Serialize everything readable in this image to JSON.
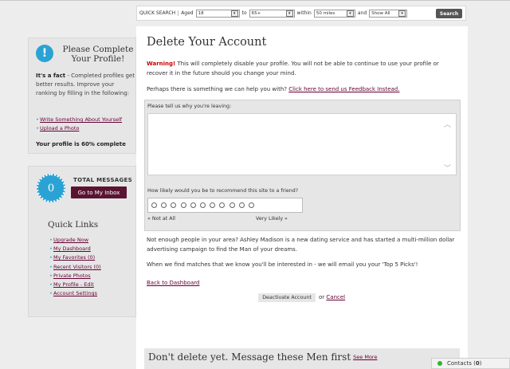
{
  "search": {
    "quick_search": "QUICK SEARCH",
    "aged": "Aged",
    "age_from": "18",
    "to": "to",
    "age_to": "65+",
    "within": "within",
    "distance": "50 miles",
    "and": "and",
    "show": "Show All",
    "button": "Search"
  },
  "profile_panel": {
    "title": "Please Complete Your Profile!",
    "fact_bold": "It's a fact",
    "fact_text": " - Completed profiles get better results. Improve your ranking by filling in the following:",
    "links": [
      "Write Something About Yourself",
      "Upload a Photo"
    ],
    "complete": "Your profile is 60% complete"
  },
  "messages_panel": {
    "count": "0",
    "label": "TOTAL MESSAGES",
    "inbox_button": "Go to My Inbox",
    "quick_links_title": "Quick Links",
    "links": [
      "Upgrade Now",
      "My Dashboard",
      "My Favorites (0)",
      "Recent Visitors (0)",
      "Private Photos"
    ],
    "my_profile": "My Profile",
    "dash": " - ",
    "edit": "Edit",
    "account_settings": "Account Settings"
  },
  "main": {
    "title": "Delete Your Account",
    "warning_label": "Warning!",
    "warning_text": " This will completely disable your profile. You will not be able to continue to use your profile or recover it in the future should you change your mind.",
    "help_text": "Perhaps there is something we can help you with? ",
    "feedback_link": "Click here to send us Feedback Instead.",
    "reason_label": "Please tell us why you're leaving:",
    "reason_value": "",
    "recommend_label": "How likely would you be to recommend this site to a friend?",
    "scale_low": "« Not at All",
    "scale_high": "Very Likely »",
    "promo_text": "Not enough people in your area? Ashley Madison is a new dating service and has started a multi-million dollar advertising campaign to find the Man of your dreams.",
    "match_text": "When we find matches that we know you'll be interested in - we will email you your 'Top 5 Picks'!",
    "back_link": "Back to Dashboard",
    "deactivate_button": "Deactivate Account",
    "or": "or",
    "cancel_link": "Cancel",
    "bottom_title": "Don't delete yet. Message these Men first",
    "see_more": "See More"
  },
  "contacts": {
    "label": "Contacts (",
    "count": "0",
    "close": ")"
  }
}
